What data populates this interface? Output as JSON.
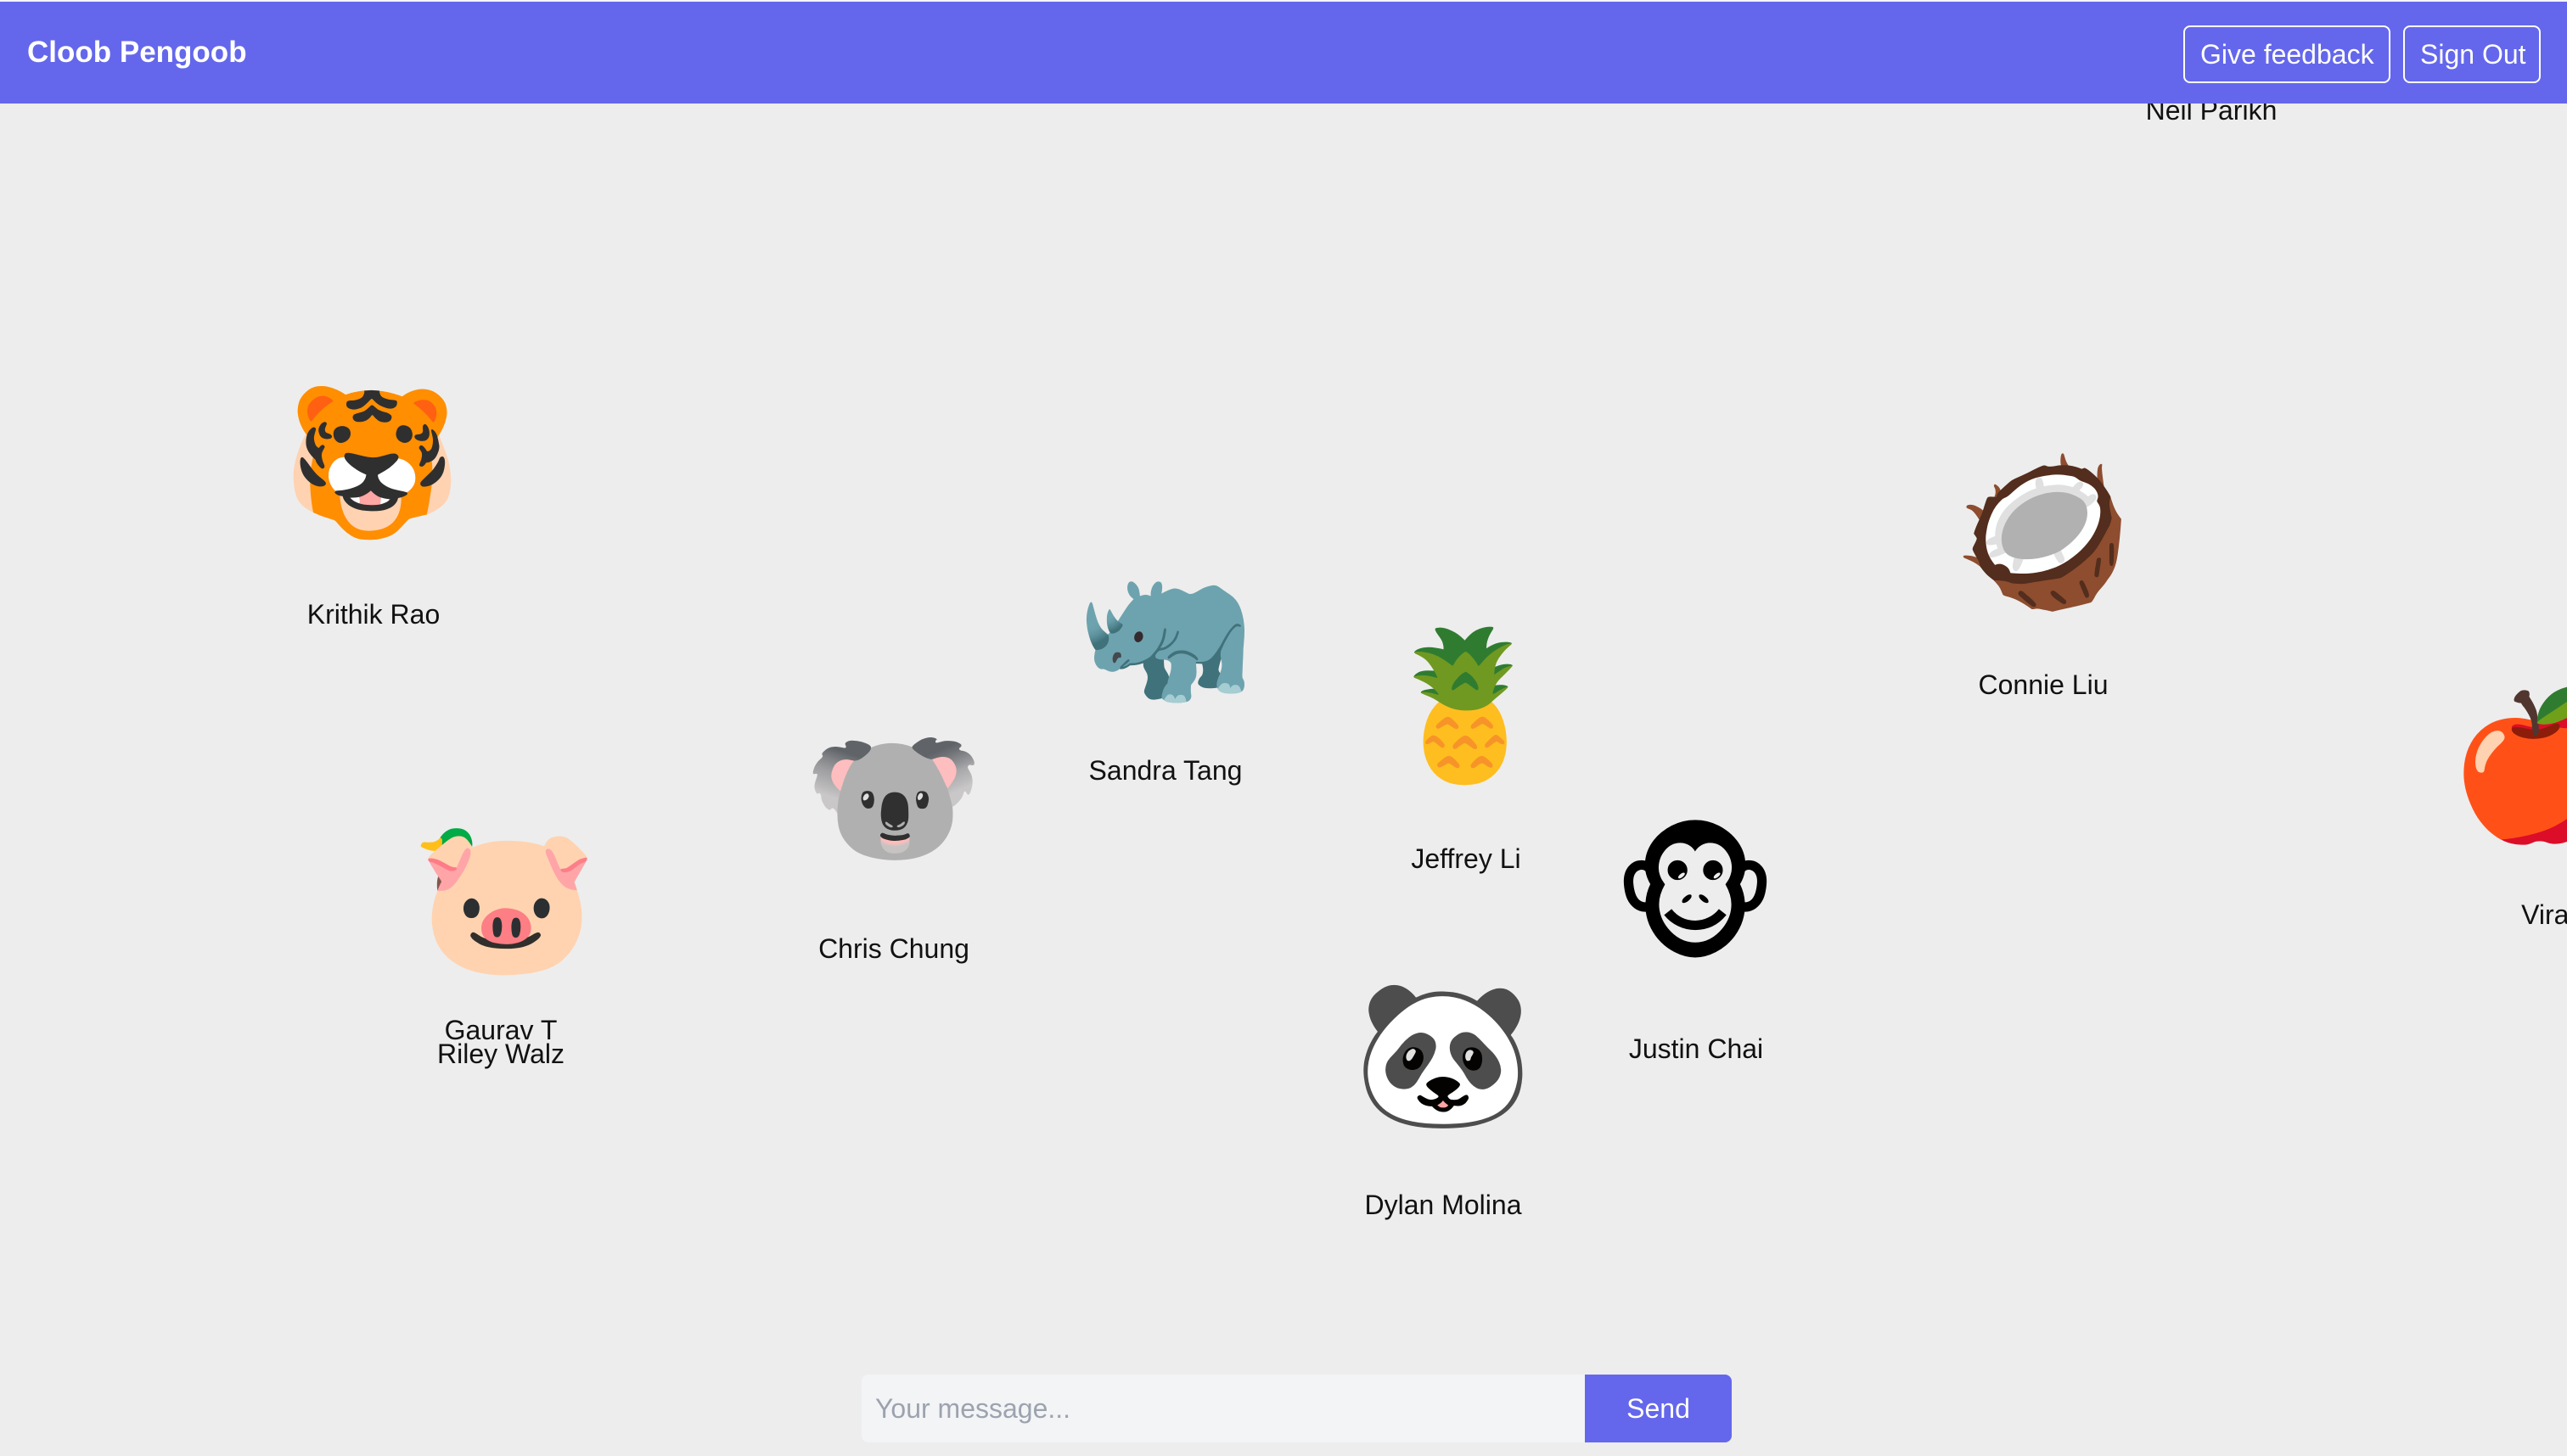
{
  "navbar": {
    "brand": "Cloob Pengoob",
    "feedback_label": "Give feedback",
    "signout_label": "Sign Out",
    "color": "#6467ec"
  },
  "users": {
    "neil": {
      "name": "Neil Parikh"
    },
    "krithik": {
      "name": "Krithik Rao",
      "avatar": "🐯",
      "icon": "tiger-face"
    },
    "sandra": {
      "name": "Sandra Tang",
      "avatar": "🦏",
      "icon": "rhinoceros"
    },
    "connie": {
      "name": "Connie Liu",
      "avatar": "🥥",
      "icon": "coconut"
    },
    "jeffrey": {
      "name": "Jeffrey Li",
      "avatar": "🍍",
      "icon": "pineapple"
    },
    "chris": {
      "name": "Chris Chung",
      "avatar": "🐨",
      "icon": "koala"
    },
    "viraat": {
      "name": "Viraat",
      "avatar": "🍎",
      "icon": "red-apple"
    },
    "justin": {
      "name": "Justin Chai",
      "avatar": "🐵",
      "icon": "monkey-face"
    },
    "gaurav": {
      "name": "Gaurav T",
      "avatar": "🦆",
      "icon": "duck"
    },
    "riley": {
      "name": "Riley Walz",
      "avatar": "🐷",
      "icon": "pig-face"
    },
    "dylan": {
      "name": "Dylan Molina",
      "avatar": "🐼",
      "icon": "panda-face"
    }
  },
  "chat": {
    "placeholder": "Your message...",
    "value": "",
    "send_label": "Send"
  }
}
